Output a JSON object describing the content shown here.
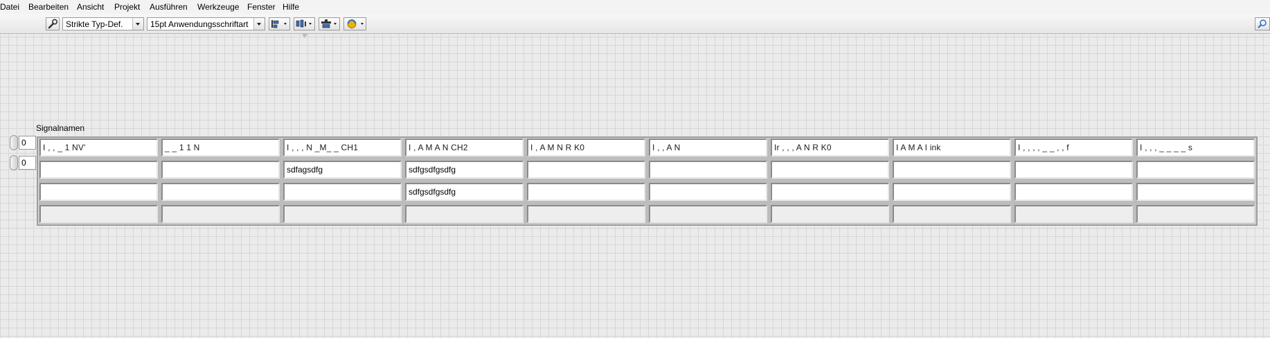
{
  "menu": [
    "Datei",
    "Bearbeiten",
    "Ansicht",
    "Projekt",
    "Ausführen",
    "Werkzeuge",
    "Fenster",
    "Hilfe"
  ],
  "toolbar": {
    "typedef_label": "Strikte Typ-Def.",
    "font_label": "15pt Anwendungsschriftart",
    "icons": [
      "wrench-icon",
      "align-objects-icon",
      "distribute-objects-icon",
      "resize-objects-icon",
      "reorder-icon",
      "search-icon"
    ]
  },
  "control": {
    "label": "Signalnamen",
    "row_index": "0",
    "column_index": "0"
  },
  "table": {
    "header": [
      "I  ,     ,           _ 1  NV' ",
      "         _      _ 1 1  N  ",
      "I     ,     ,  ,  N   _M_ _  CH1",
      "I  ,   A  M  A  N  CH2",
      "I  ,   A  M  N  R  K0",
      "I  ,  ,      A  N",
      "Ir  ,  ,  ,  A  N  R  K0",
      "I     A  M  A  I  ink",
      "I  ,  ,  ,  ,   _    _ ,   ,  f",
      "I  ,  ,   ,   _  _  _  _  s"
    ],
    "rows": [
      [
        "",
        "",
        "sdfagsdfg",
        "sdfgsdfgsdfg",
        "",
        "",
        "",
        "",
        "",
        ""
      ],
      [
        "",
        "",
        "",
        "sdfgsdfgsdfg",
        "",
        "",
        "",
        "",
        "",
        ""
      ],
      [
        "",
        "",
        "",
        "",
        "",
        "",
        "",
        "",
        "",
        ""
      ]
    ]
  }
}
